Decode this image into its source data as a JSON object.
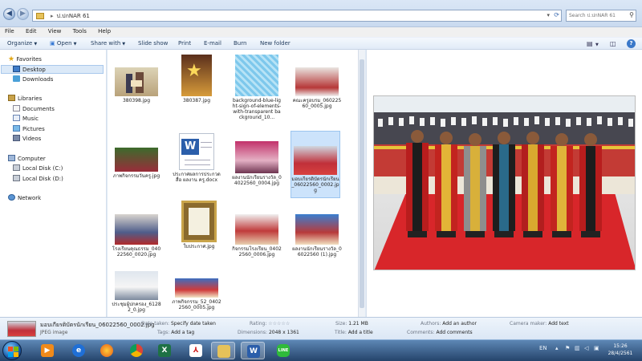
{
  "address_bar": {
    "back_icon": "arrow-left-icon",
    "path_segment": "ป.ปกNAR 61",
    "search_placeholder": "Search ป.ปกNAR 61"
  },
  "menu": [
    "File",
    "Edit",
    "View",
    "Tools",
    "Help"
  ],
  "toolbar": {
    "organize": "Organize",
    "open_with": "Open",
    "share_with": "Share with",
    "slide_show": "Slide show",
    "print": "Print",
    "email": "E-mail",
    "burn": "Burn",
    "new_folder": "New folder"
  },
  "nav": {
    "favorites": "Favorites",
    "desktop": "Desktop",
    "downloads": "Downloads",
    "libraries": "Libraries",
    "documents": "Documents",
    "music": "Music",
    "pictures": "Pictures",
    "videos": "Videos",
    "computer": "Computer",
    "local_disk_c": "Local Disk (C:)",
    "local_disk_d": "Local Disk (D:)",
    "network": "Network"
  },
  "files": [
    {
      "name": "380398.jpg"
    },
    {
      "name": "380387.jpg"
    },
    {
      "name": "background-blue-light-sign-of-elements-with-transparent background_10..."
    },
    {
      "name": "คณะครูอบรม_06022560_0005.jpg"
    },
    {
      "name": "ภาพกิจกรรมวันครู.jpg"
    },
    {
      "name": "ประกาศผลการประกวดสื่อ ผลงาน ครู.docx"
    },
    {
      "name": "ผลงานนักเรียนรางวัล_04022560_0004.jpg"
    },
    {
      "name": "มอบเกียรติบัตรนักเรียน_06022560_0002.jpg"
    },
    {
      "name": "โรงเรียนคุณธรรม_04022560_0020.jpg"
    },
    {
      "name": "ใบประกาศ.jpg"
    },
    {
      "name": "กิจกรรมโรงเรียน_04022560_0006.jpg"
    },
    {
      "name": "ผลงานนักเรียนรางวัล_06022560 (1).jpg"
    },
    {
      "name": "ประชุมผู้ปกครอง_61282_0.jpg"
    },
    {
      "name": "ภาพกิจกรรม_52_04022560_0005.jpg"
    }
  ],
  "details": {
    "filename": "มอบเกียรติบัตรนักเรียน_06022560_0002.jpg",
    "filetype": "JPEG image",
    "date_taken_label": "Date taken:",
    "date_taken_value": "Specify date taken",
    "tags_label": "Tags:",
    "tags_value": "Add a tag",
    "rating_label": "Rating:",
    "rating_value": "☆☆☆☆☆",
    "dimensions_label": "Dimensions:",
    "dimensions_value": "2048 x 1361",
    "size_label": "Size:",
    "size_value": "1.21 MB",
    "title_label": "Title:",
    "title_value": "Add a title",
    "authors_label": "Authors:",
    "authors_value": "Add an author",
    "comments_label": "Comments:",
    "comments_value": "Add comments",
    "camera_label": "Camera maker:",
    "camera_value": "Add text"
  },
  "taskbar": {
    "apps": [
      "media-player-icon",
      "internet-explorer-icon",
      "firefox-icon",
      "chrome-icon",
      "excel-icon",
      "pdf-reader-icon",
      "file-explorer-icon",
      "word-icon",
      "line-icon"
    ],
    "lang": "EN",
    "time": "15:26",
    "date": "28/4/2561"
  }
}
